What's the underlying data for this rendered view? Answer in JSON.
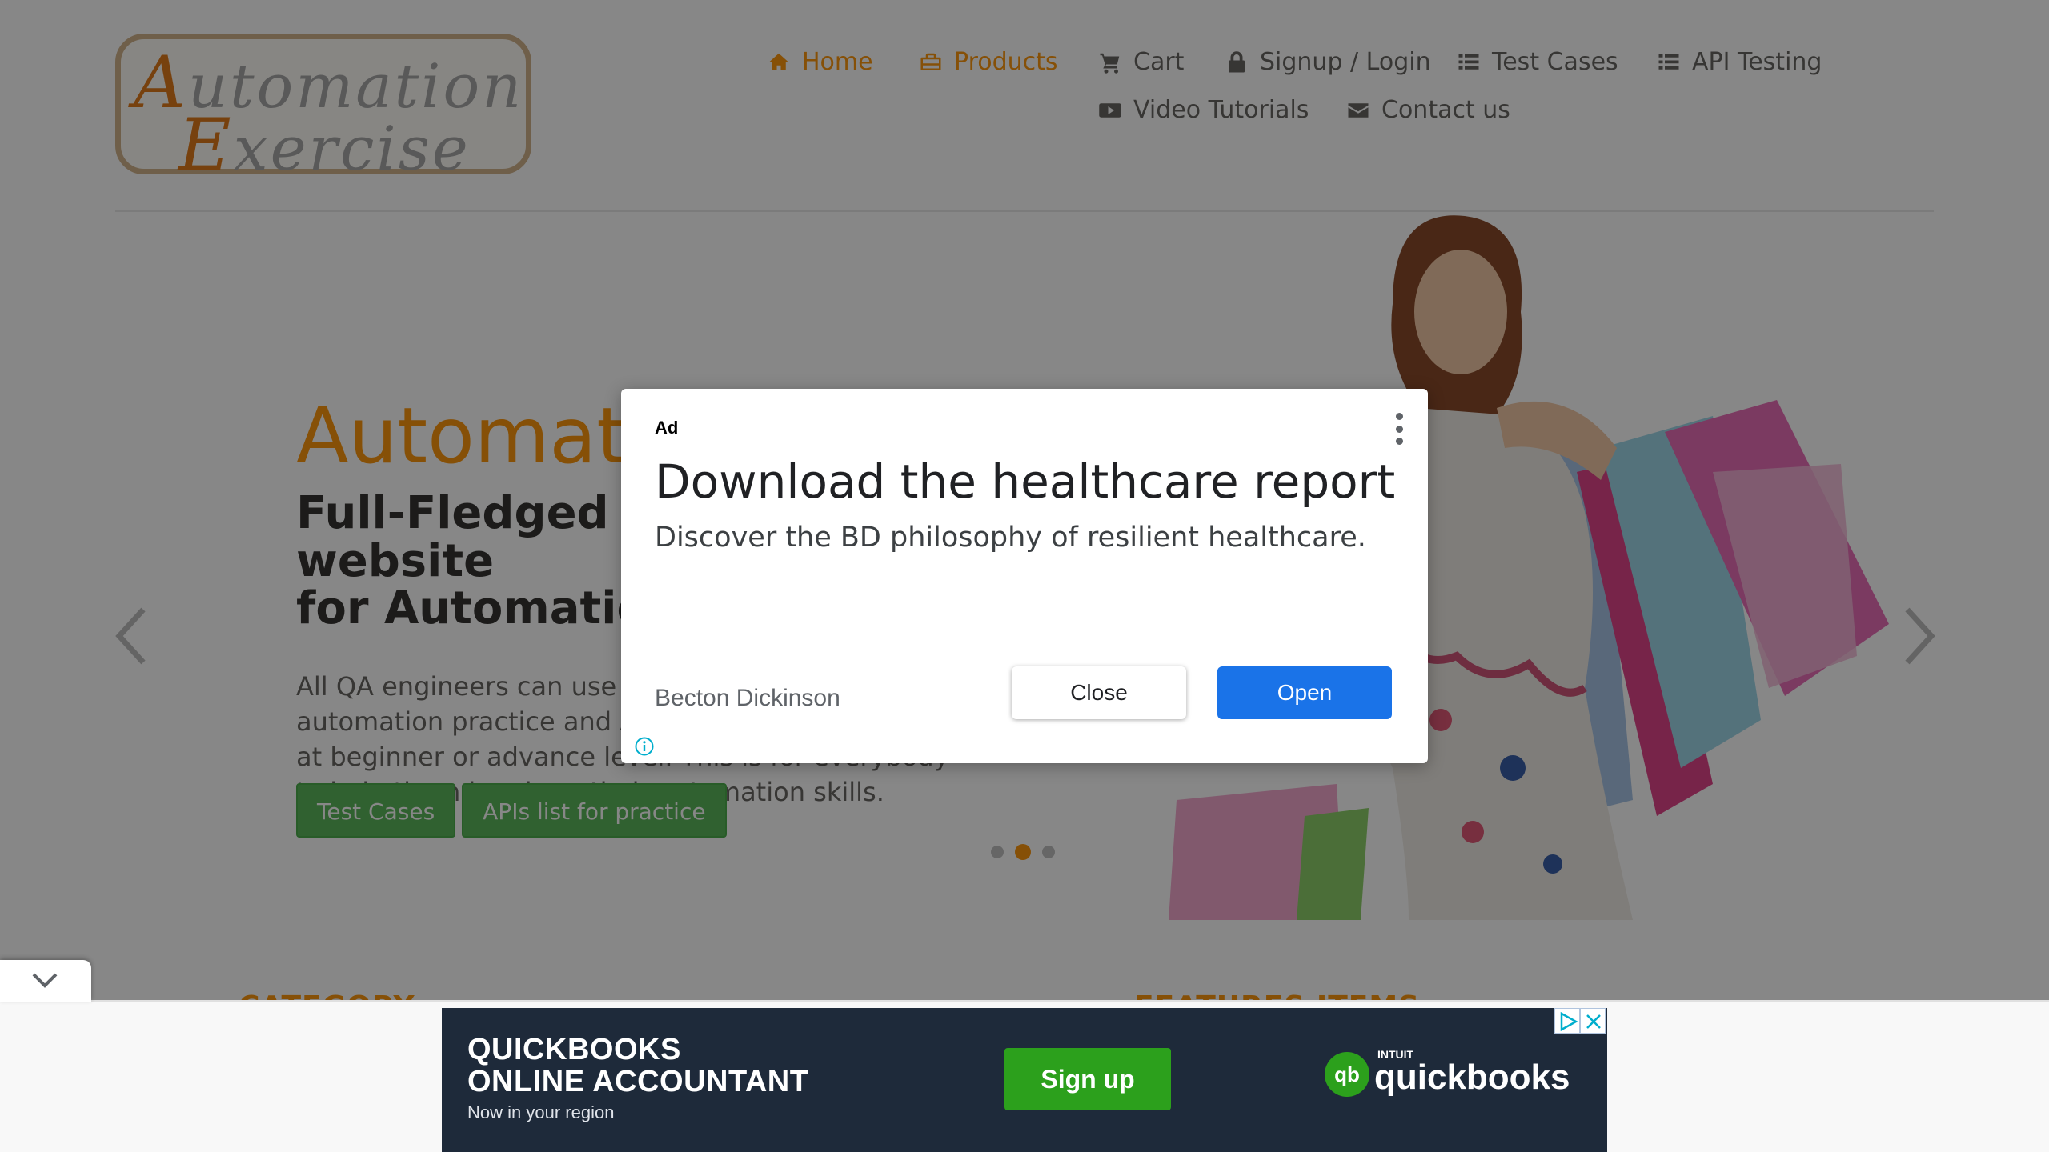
{
  "logo": {
    "line1": "Automation",
    "line2": "Exercise"
  },
  "nav": {
    "items": [
      {
        "label": "Home",
        "icon": "home-icon"
      },
      {
        "label": "Products",
        "icon": "briefcase-icon"
      },
      {
        "label": "Cart",
        "icon": "cart-icon"
      },
      {
        "label": "Signup / Login",
        "icon": "lock-icon"
      },
      {
        "label": "Test Cases",
        "icon": "list-icon"
      },
      {
        "label": "API Testing",
        "icon": "list-icon"
      },
      {
        "label": "Video Tutorials",
        "icon": "youtube-icon"
      },
      {
        "label": "Contact us",
        "icon": "envelope-icon"
      }
    ]
  },
  "hero": {
    "title": "AutomationExercise",
    "subtitle": "Full-Fledged practice website\nfor Automation Engineers",
    "description": "All QA engineers can use this website for automation practice and API testing either they are at beginner or advance level. This is for everybody to help them brush up their automation skills.",
    "buttons": {
      "test_cases": "Test Cases",
      "apis": "APIs list for practice"
    },
    "active_slide": 2,
    "slide_count": 3
  },
  "sections": {
    "category": "CATEGORY",
    "features": "FEATURES ITEMS"
  },
  "ad_dialog": {
    "label": "Ad",
    "headline": "Download the healthcare report",
    "description": "Discover the BD philosophy of resilient healthcare.",
    "advertiser": "Becton Dickinson",
    "close_label": "Close",
    "open_label": "Open"
  },
  "bottom_banner": {
    "title": "QUICKBOOKS\nONLINE ACCOUNTANT",
    "subtitle": "Now in your region",
    "button": "Sign up",
    "brand_intuit": "INTUIT",
    "brand_name": "quickbooks",
    "brand_icon_text": "qb"
  },
  "colors": {
    "accent": "#fe980f",
    "green": "#5cb85c",
    "ad_open_blue": "#1a73e8",
    "banner_bg": "#1e2a3a",
    "quickbooks_green": "#2ca01c"
  }
}
